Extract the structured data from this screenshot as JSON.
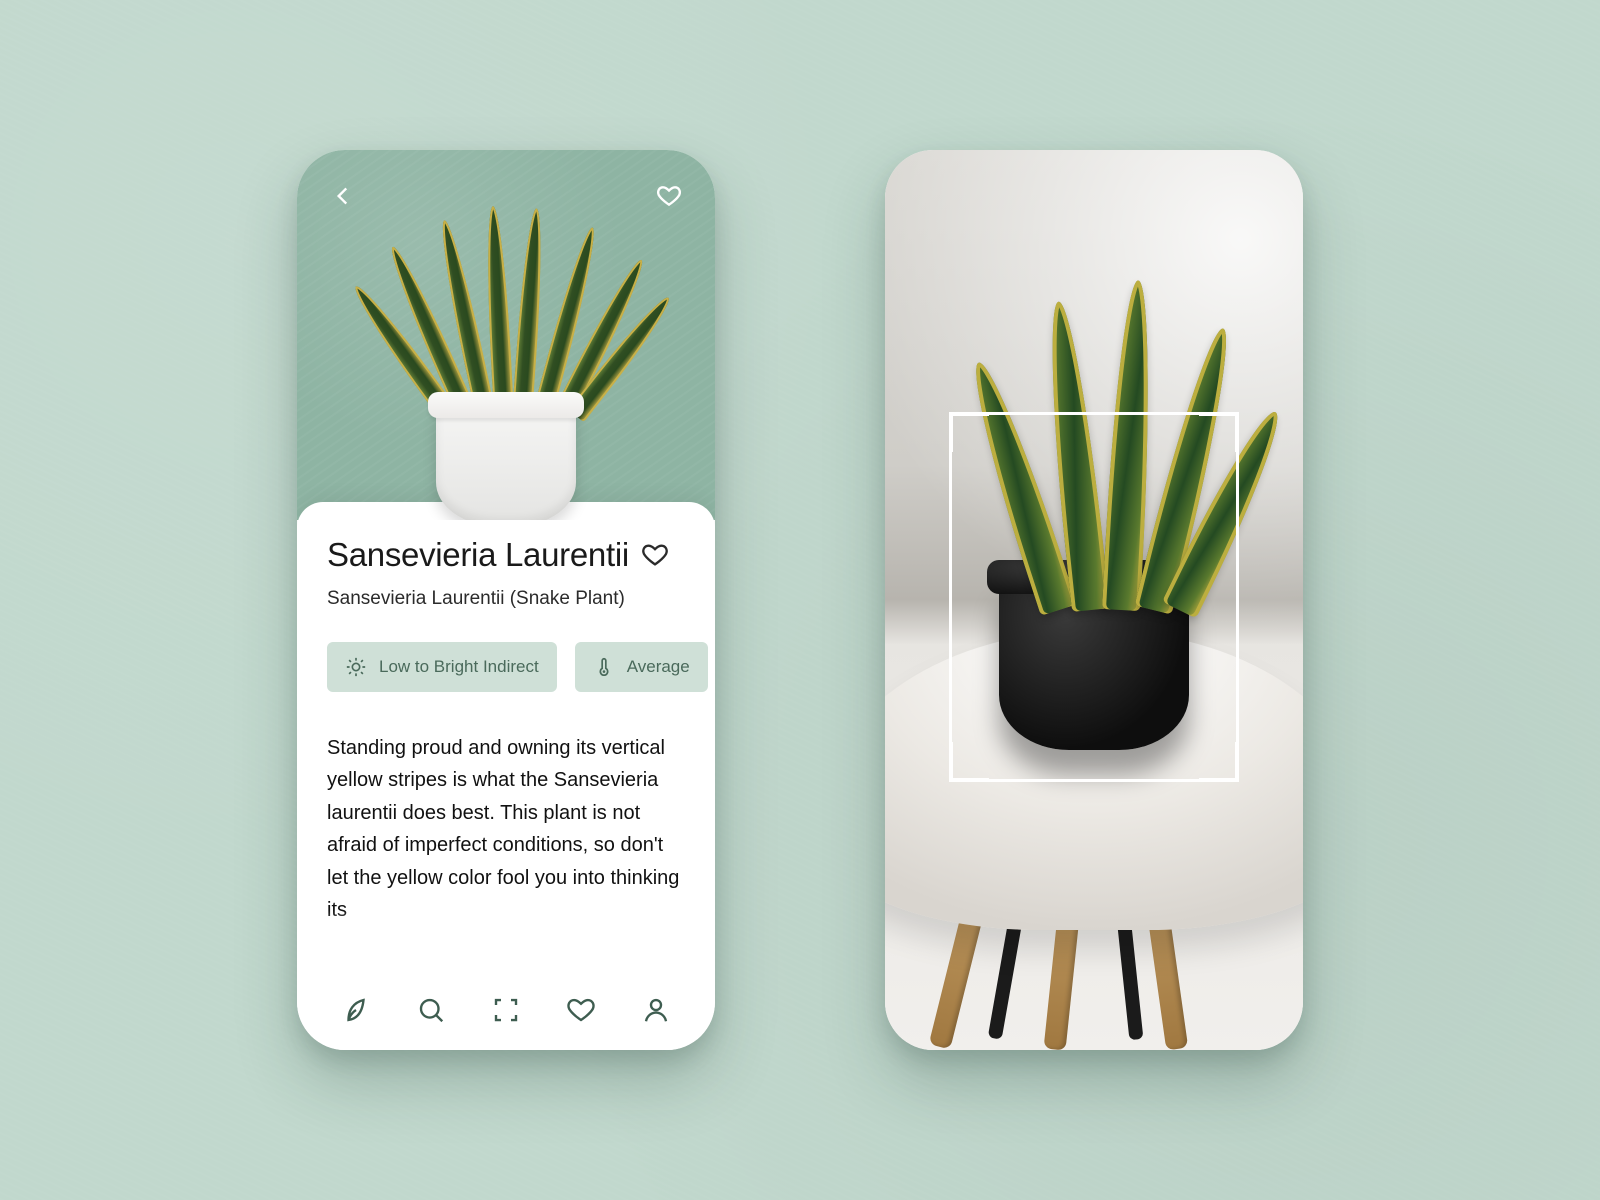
{
  "colors": {
    "bg": "#c1d8cd",
    "hero": "#8eb4a3",
    "chip_bg": "#cfe0d7",
    "chip_fg": "#4a6a5b",
    "tab_icon": "#3e5d50"
  },
  "detail": {
    "title": "Sansevieria Laurentii",
    "subtitle": "Sansevieria Laurentii (Snake Plant)",
    "care": {
      "light": "Low to Bright Indirect",
      "temperature": "Average"
    },
    "description": "Standing proud and owning its vertical yellow stripes is what the Sansevieria laurentii does best.  This plant is not afraid of imperfect conditions, so don't let the yellow color fool you into thinking its"
  },
  "tabs": [
    "plants",
    "search",
    "scan",
    "favorites",
    "profile"
  ],
  "scanner": {
    "mode": "camera",
    "frame_visible": true
  }
}
